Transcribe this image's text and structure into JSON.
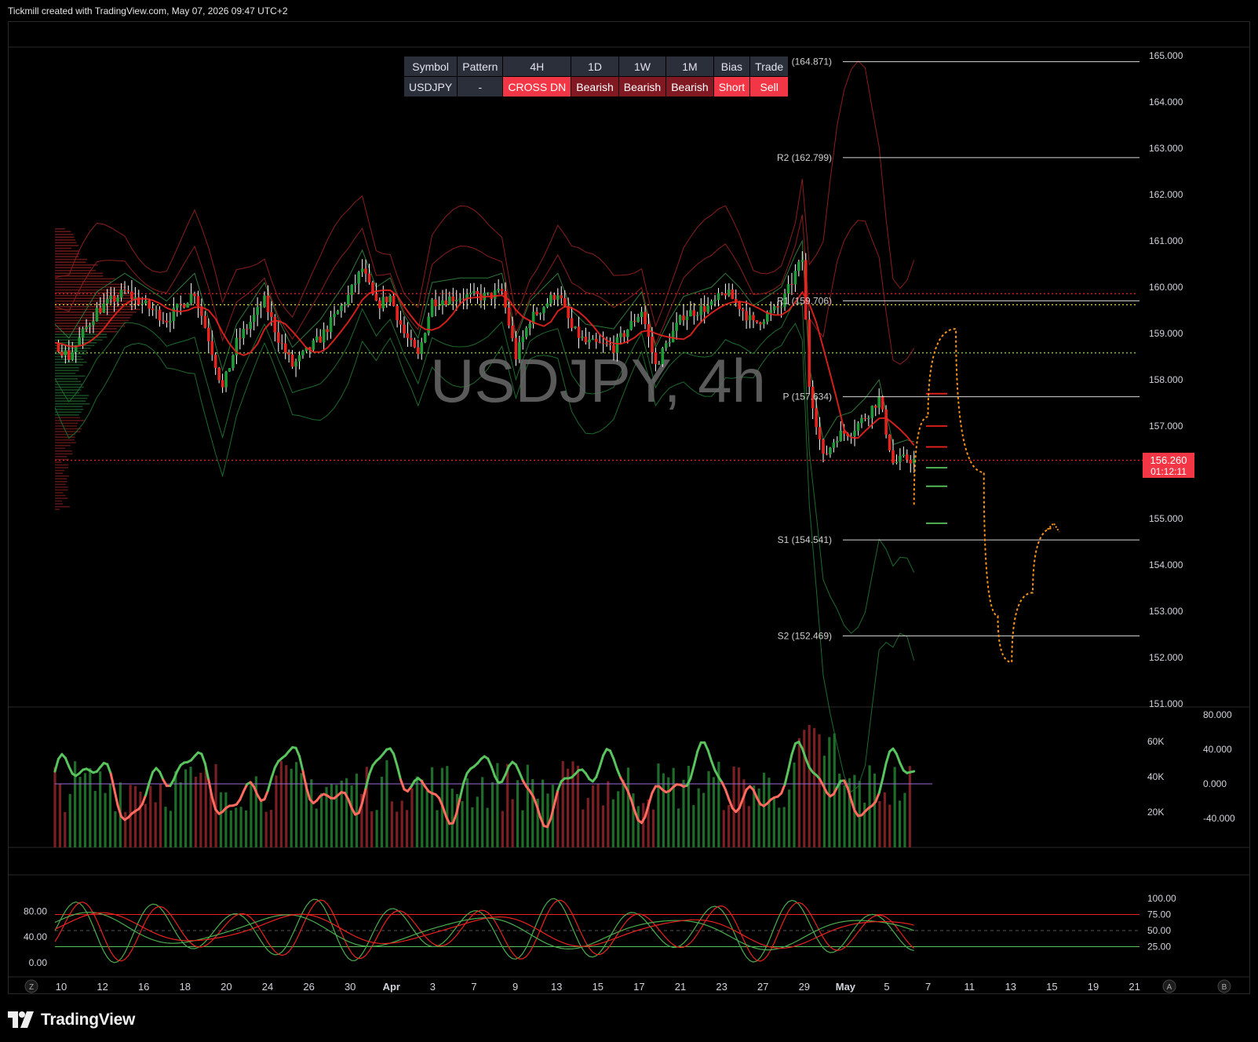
{
  "header": {
    "text": "Tickmill created with TradingView.com, May 07, 2026 09:47 UTC+2"
  },
  "brand": {
    "name": "TradingView"
  },
  "colors": {
    "up": "#1f9b3a",
    "down": "#e8231f",
    "ma_red": "#e8231f",
    "forecast": "#f7931a",
    "last_price_bg": "#f23645",
    "band_red": "#8b1e1e",
    "band_green": "#1d6b2e",
    "cmf_up": "#59c45e",
    "cmf_down": "#ff6b5e"
  },
  "table": {
    "headers": [
      "Symbol",
      "Pattern",
      "4H",
      "1D",
      "1W",
      "1M",
      "Bias",
      "Trade"
    ],
    "row": [
      {
        "text": "USDJPY",
        "style": "neutral"
      },
      {
        "text": "-",
        "style": "neutral"
      },
      {
        "text": "CROSS DN",
        "style": "hot"
      },
      {
        "text": "Bearish",
        "style": "dark"
      },
      {
        "text": "Bearish",
        "style": "dark"
      },
      {
        "text": "Bearish",
        "style": "dark"
      },
      {
        "text": "Short",
        "style": "hot"
      },
      {
        "text": "Sell",
        "style": "hot"
      }
    ]
  },
  "chart_data": [
    {
      "type": "candlestick",
      "title": "USDJPY, 4h",
      "symbol": "USDJPY",
      "interval": "4h",
      "ylim": [
        150.8,
        165.2
      ],
      "y_ticks": [
        "165.000",
        "164.000",
        "163.000",
        "162.000",
        "161.000",
        "160.000",
        "159.000",
        "158.000",
        "157.000",
        "156.000",
        "155.000",
        "154.000",
        "153.000",
        "152.000",
        "151.000"
      ],
      "x_ticks": [
        "10",
        "12",
        "16",
        "18",
        "20",
        "24",
        "26",
        "30",
        "Apr",
        "3",
        "7",
        "9",
        "13",
        "15",
        "17",
        "21",
        "23",
        "27",
        "29",
        "May",
        "5",
        "7",
        "11",
        "13",
        "15",
        "19",
        "21"
      ],
      "last_price": {
        "value": "156.260",
        "countdown": "01:12:11"
      },
      "pivots": [
        {
          "label": "R3 (164.871)",
          "value": 164.871
        },
        {
          "label": "R2 (162.799)",
          "value": 162.799
        },
        {
          "label": "R1 (159.706)",
          "value": 159.706
        },
        {
          "label": "P (157.634)",
          "value": 157.634
        },
        {
          "label": "S1 (154.541)",
          "value": 154.541
        },
        {
          "label": "S2 (152.469)",
          "value": 152.469
        }
      ],
      "horizontal_levels": [
        {
          "value": 159.86,
          "style": "red-dotted"
        },
        {
          "value": 159.62,
          "style": "yellow-dotted"
        },
        {
          "value": 158.58,
          "style": "green-dotted"
        },
        {
          "value": 156.26,
          "style": "red-dotted"
        }
      ],
      "close_path": [
        {
          "d": 0,
          "c": 158.8
        },
        {
          "d": 1,
          "c": 158.5
        },
        {
          "d": 3,
          "c": 159.5
        },
        {
          "d": 5,
          "c": 159.9
        },
        {
          "d": 8,
          "c": 159.3
        },
        {
          "d": 10,
          "c": 159.9
        },
        {
          "d": 11,
          "c": 158.9
        },
        {
          "d": 12,
          "c": 157.8
        },
        {
          "d": 13,
          "c": 158.8
        },
        {
          "d": 15,
          "c": 159.7
        },
        {
          "d": 16,
          "c": 158.9
        },
        {
          "d": 17,
          "c": 158.3
        },
        {
          "d": 19,
          "c": 158.9
        },
        {
          "d": 21,
          "c": 159.8
        },
        {
          "d": 22,
          "c": 160.4
        },
        {
          "d": 23,
          "c": 159.6
        },
        {
          "d": 24,
          "c": 159.8
        },
        {
          "d": 25,
          "c": 159.0
        },
        {
          "d": 26,
          "c": 158.5
        },
        {
          "d": 27,
          "c": 159.7
        },
        {
          "d": 29,
          "c": 159.8
        },
        {
          "d": 31,
          "c": 159.8
        },
        {
          "d": 32,
          "c": 159.9
        },
        {
          "d": 33,
          "c": 158.5
        },
        {
          "d": 34,
          "c": 159.3
        },
        {
          "d": 36,
          "c": 159.9
        },
        {
          "d": 37,
          "c": 159.1
        },
        {
          "d": 38,
          "c": 158.8
        },
        {
          "d": 40,
          "c": 158.7
        },
        {
          "d": 42,
          "c": 159.5
        },
        {
          "d": 43,
          "c": 158.3
        },
        {
          "d": 44,
          "c": 158.9
        },
        {
          "d": 45,
          "c": 159.4
        },
        {
          "d": 47,
          "c": 159.6
        },
        {
          "d": 48,
          "c": 159.9
        },
        {
          "d": 49,
          "c": 159.6
        },
        {
          "d": 50,
          "c": 159.2
        },
        {
          "d": 51,
          "c": 159.4
        },
        {
          "d": 52,
          "c": 159.6
        },
        {
          "d": 53,
          "c": 160.3
        },
        {
          "d": 53.5,
          "c": 160.6
        },
        {
          "d": 54,
          "c": 157.9
        },
        {
          "d": 55,
          "c": 156.3
        },
        {
          "d": 56,
          "c": 156.8
        },
        {
          "d": 57,
          "c": 156.9
        },
        {
          "d": 58,
          "c": 157.2
        },
        {
          "d": 59,
          "c": 157.6
        },
        {
          "d": 60,
          "c": 156.2
        },
        {
          "d": 61,
          "c": 156.3
        },
        {
          "d": 61.5,
          "c": 156.26
        }
      ],
      "forecast_path": [
        {
          "d": 61.5,
          "c": 155.3
        },
        {
          "d": 62.5,
          "c": 157.2
        },
        {
          "d": 64.5,
          "c": 159.1
        },
        {
          "d": 66.5,
          "c": 156.0
        },
        {
          "d": 67.5,
          "c": 152.9
        },
        {
          "d": 68.5,
          "c": 151.9
        },
        {
          "d": 70,
          "c": 153.4
        },
        {
          "d": 71.5,
          "c": 154.8
        }
      ]
    },
    {
      "type": "bar+line",
      "name": "volume-cmf",
      "volume_ticks": [
        "60K",
        "40K",
        "20K"
      ],
      "osc_ticks": [
        "80.000",
        "40.000",
        "0.000",
        "-40.000"
      ]
    },
    {
      "type": "line",
      "name": "stochastic",
      "left_ticks": [
        "80.00",
        "40.00",
        "0.00"
      ],
      "right_ticks": [
        "100.00",
        "75.00",
        "50.00",
        "25.00"
      ],
      "levels": [
        75,
        25
      ]
    }
  ],
  "scale_buttons": {
    "left": "Z",
    "a": "A",
    "b": "B"
  }
}
